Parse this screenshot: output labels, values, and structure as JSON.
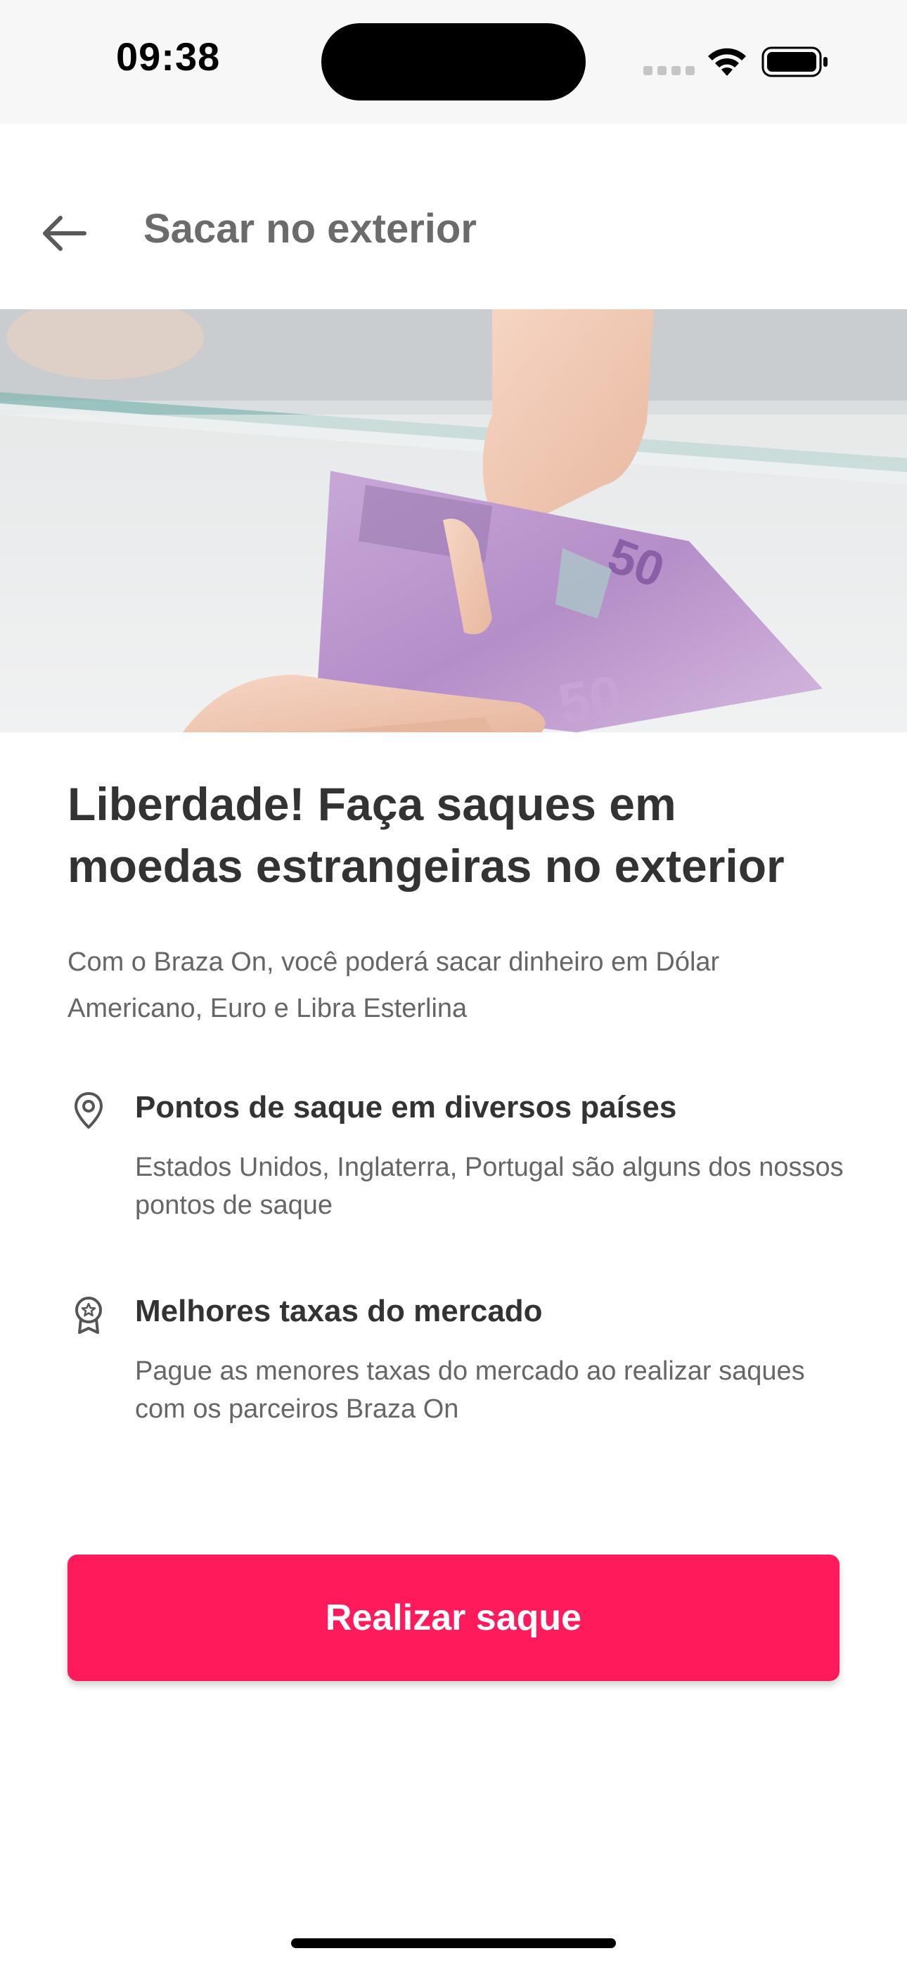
{
  "status_bar": {
    "time": "09:38"
  },
  "header": {
    "title": "Sacar no exterior",
    "back_icon": "arrow-left-icon"
  },
  "hero": {
    "note_value": "50"
  },
  "main": {
    "headline": "Liberdade! Faça saques em moedas estrangeiras no exterior",
    "description": "Com o Braza On, você poderá sacar dinheiro em Dólar Americano, Euro e Libra Esterlina",
    "features": [
      {
        "icon": "map-pin-icon",
        "title": "Pontos de saque em diversos países",
        "text": "Estados Unidos, Inglaterra, Portugal são alguns dos nossos pontos de saque"
      },
      {
        "icon": "award-badge-icon",
        "title": "Melhores taxas do mercado",
        "text": "Pague as menores taxas do mercado ao realizar saques com os parceiros Braza On"
      }
    ]
  },
  "cta": {
    "label": "Realizar saque"
  },
  "colors": {
    "accent": "#ff1a5c",
    "heading": "#333333",
    "body_text": "#666666",
    "title_gray": "#6b6b6b"
  }
}
